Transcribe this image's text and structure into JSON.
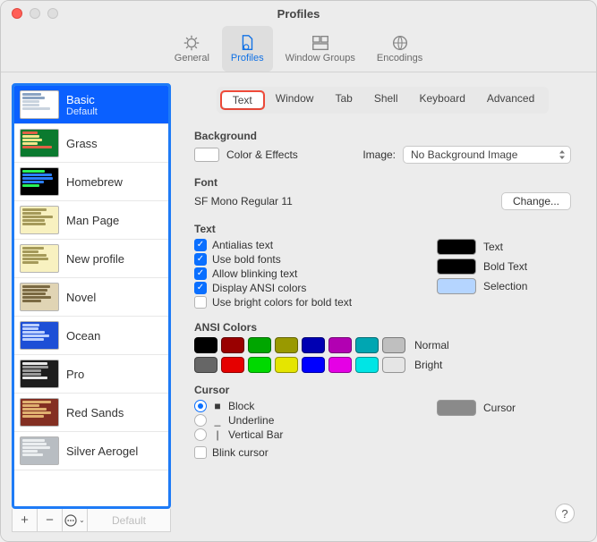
{
  "window": {
    "title": "Profiles"
  },
  "toolbar": {
    "items": [
      {
        "label": "General"
      },
      {
        "label": "Profiles"
      },
      {
        "label": "Window Groups"
      },
      {
        "label": "Encodings"
      }
    ]
  },
  "profiles": [
    {
      "name": "Basic",
      "subtitle": "Default",
      "thumb": {
        "bg": "#ffffff",
        "lines": [
          "#8aa3c2",
          "#8aa3c2",
          "#c9d3de",
          "#c9d3de",
          "#c9d3de"
        ]
      }
    },
    {
      "name": "Grass",
      "thumb": {
        "bg": "#0b7a2f",
        "lines": [
          "#e06146",
          "#f5e58a",
          "#f5e58a",
          "#f5e58a",
          "#e06146"
        ]
      }
    },
    {
      "name": "Homebrew",
      "thumb": {
        "bg": "#000000",
        "lines": [
          "#29f25a",
          "#2b7fff",
          "#2b7fff",
          "#2b7fff",
          "#29f25a"
        ]
      }
    },
    {
      "name": "Man Page",
      "thumb": {
        "bg": "#f8f1c0",
        "lines": [
          "#a59a5a",
          "#a59a5a",
          "#a59a5a",
          "#a59a5a",
          "#a59a5a"
        ]
      }
    },
    {
      "name": "New profile",
      "thumb": {
        "bg": "#f8f1c0",
        "lines": [
          "#a59a5a",
          "#a59a5a",
          "#a59a5a",
          "#a59a5a",
          "#a59a5a"
        ]
      }
    },
    {
      "name": "Novel",
      "thumb": {
        "bg": "#e0d4b4",
        "lines": [
          "#7b6a43",
          "#7b6a43",
          "#7b6a43",
          "#7b6a43",
          "#7b6a43"
        ]
      }
    },
    {
      "name": "Ocean",
      "thumb": {
        "bg": "#1d4fd6",
        "lines": [
          "#bcd0ff",
          "#bcd0ff",
          "#bcd0ff",
          "#bcd0ff",
          "#bcd0ff"
        ]
      }
    },
    {
      "name": "Pro",
      "thumb": {
        "bg": "#1d1d1d",
        "lines": [
          "#e6e6e6",
          "#999999",
          "#999999",
          "#999999",
          "#e6e6e6"
        ]
      }
    },
    {
      "name": "Red Sands",
      "thumb": {
        "bg": "#832f22",
        "lines": [
          "#e0b070",
          "#e0b070",
          "#e0b070",
          "#e0b070",
          "#e0b070"
        ]
      }
    },
    {
      "name": "Silver Aerogel",
      "thumb": {
        "bg": "#b8bdc2",
        "lines": [
          "#ebeef0",
          "#ebeef0",
          "#ebeef0",
          "#ebeef0",
          "#ebeef0"
        ]
      }
    }
  ],
  "sidebar_footer": {
    "default_label": "Default"
  },
  "tabs": [
    "Text",
    "Window",
    "Tab",
    "Shell",
    "Keyboard",
    "Advanced"
  ],
  "content": {
    "background": {
      "heading": "Background",
      "color_effects": "Color & Effects",
      "image_label": "Image:",
      "image_value": "No Background Image"
    },
    "font": {
      "heading": "Font",
      "value": "SF Mono Regular 11",
      "change_btn": "Change..."
    },
    "text": {
      "heading": "Text",
      "options": [
        {
          "label": "Antialias text",
          "checked": true
        },
        {
          "label": "Use bold fonts",
          "checked": true
        },
        {
          "label": "Allow blinking text",
          "checked": true
        },
        {
          "label": "Display ANSI colors",
          "checked": true
        },
        {
          "label": "Use bright colors for bold text",
          "checked": false
        }
      ],
      "swatches": [
        {
          "label": "Text",
          "color": "#000000"
        },
        {
          "label": "Bold Text",
          "color": "#000000"
        },
        {
          "label": "Selection",
          "color": "#b5d5ff"
        }
      ]
    },
    "ansi": {
      "heading": "ANSI Colors",
      "normal_label": "Normal",
      "bright_label": "Bright",
      "normal": [
        "#000000",
        "#990000",
        "#00a600",
        "#999900",
        "#0000b2",
        "#b200b2",
        "#00a6b2",
        "#bfbfbf"
      ],
      "bright": [
        "#666666",
        "#e50000",
        "#00d900",
        "#e5e500",
        "#0000ff",
        "#e500e5",
        "#00e5e5",
        "#e5e5e5"
      ]
    },
    "cursor": {
      "heading": "Cursor",
      "styles": [
        {
          "label": "Block",
          "glyph": "■",
          "selected": true
        },
        {
          "label": "Underline",
          "glyph": "_",
          "selected": false
        },
        {
          "label": "Vertical Bar",
          "glyph": "|",
          "selected": false
        }
      ],
      "blink": {
        "label": "Blink cursor",
        "checked": false
      },
      "swatch": {
        "label": "Cursor",
        "color": "#8a8a8a"
      }
    }
  }
}
